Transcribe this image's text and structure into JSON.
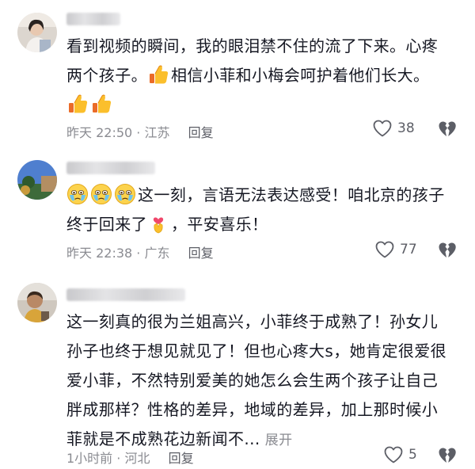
{
  "comments": [
    {
      "lines": [
        "看到视频的瞬间，我的眼泪禁不住的流了下来。心疼",
        "两个孩子。",
        "相信小菲和小梅会呵护着他们长大。"
      ],
      "time": "昨天 22:50",
      "location": "江苏",
      "reply": "回复",
      "likes": "38"
    },
    {
      "lines": [
        "这一刻，言语无法表达感受！咱北京的孩子",
        "终于回来了",
        "，平安喜乐！"
      ],
      "time": "昨天 22:38",
      "location": "广东",
      "reply": "回复",
      "likes": "77"
    },
    {
      "lines": [
        "这一刻真的很为兰姐高兴，小菲终于成熟了！孙女儿",
        "孙子也终于想见就见了！但也心疼大s，她肯定很爱很",
        "爱小菲，不然特别爱美的她怎么会生两个孩子让自己",
        "胖成那样？性格的差异，地域的差异，加上那时候小",
        "菲就是不成熟花边新闻不..."
      ],
      "expand": "展开",
      "time": "1小时前",
      "location": "河北",
      "reply": "回复",
      "likes": "5"
    }
  ],
  "sep": "·"
}
